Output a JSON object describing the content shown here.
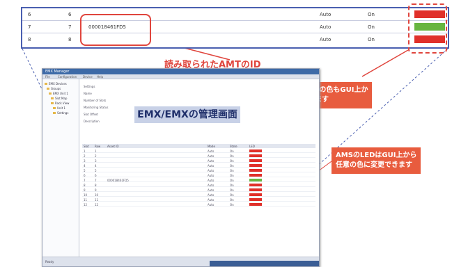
{
  "zoom_table": {
    "rows": [
      {
        "col1": "6",
        "col2": "6",
        "id": "",
        "mode": "Auto",
        "state": "On",
        "led_color": "#e0302a"
      },
      {
        "col1": "7",
        "col2": "7",
        "id": "000018461FD5",
        "mode": "Auto",
        "state": "On",
        "led_color": "#68b541"
      },
      {
        "col1": "8",
        "col2": "8",
        "id": "",
        "mode": "Auto",
        "state": "On",
        "led_color": "#e0302a"
      }
    ]
  },
  "annotations": {
    "amt_id": "読み取られたAMTのID",
    "led_status_line1": "AMSのLEDの色もGUI上か",
    "led_status_line2": "ら確認できます",
    "led_change_line1": "AMSのLEDはGUI上から",
    "led_change_line2": "任意の色に変更できます",
    "app_title": "EMX/EMXの管理画面"
  },
  "window": {
    "title": "EMX Manager",
    "menu": [
      "File",
      "Configuration",
      "Device",
      "Help"
    ],
    "tree": [
      "EMX Devices",
      "Groups",
      "EMX Unit 1",
      "Slot Map",
      "Rack View",
      "Unit 1",
      "Settings"
    ],
    "fields": [
      "Settings",
      "Name",
      "Number of Slots",
      "Monitoring Status",
      "Slot Offset",
      "Description"
    ],
    "grid_headers": [
      "Slot",
      "Row",
      "Asset ID",
      "Mode",
      "State",
      "LED"
    ],
    "grid_rows": [
      {
        "slot": "1",
        "row": "1",
        "id": "",
        "mode": "Auto",
        "state": "On",
        "led_color": "#e0302a"
      },
      {
        "slot": "2",
        "row": "2",
        "id": "",
        "mode": "Auto",
        "state": "On",
        "led_color": "#e0302a"
      },
      {
        "slot": "3",
        "row": "3",
        "id": "",
        "mode": "Auto",
        "state": "On",
        "led_color": "#e0302a"
      },
      {
        "slot": "4",
        "row": "4",
        "id": "",
        "mode": "Auto",
        "state": "On",
        "led_color": "#e0302a"
      },
      {
        "slot": "5",
        "row": "5",
        "id": "",
        "mode": "Auto",
        "state": "On",
        "led_color": "#e0302a"
      },
      {
        "slot": "6",
        "row": "6",
        "id": "",
        "mode": "Auto",
        "state": "On",
        "led_color": "#e0302a"
      },
      {
        "slot": "7",
        "row": "7",
        "id": "000018461FD5",
        "mode": "Auto",
        "state": "On",
        "led_color": "#68b541"
      },
      {
        "slot": "8",
        "row": "8",
        "id": "",
        "mode": "Auto",
        "state": "On",
        "led_color": "#e0302a"
      },
      {
        "slot": "9",
        "row": "9",
        "id": "",
        "mode": "Auto",
        "state": "On",
        "led_color": "#e0302a"
      },
      {
        "slot": "10",
        "row": "10",
        "id": "",
        "mode": "Auto",
        "state": "On",
        "led_color": "#e0302a"
      },
      {
        "slot": "11",
        "row": "11",
        "id": "",
        "mode": "Auto",
        "state": "On",
        "led_color": "#e0302a"
      },
      {
        "slot": "12",
        "row": "12",
        "id": "",
        "mode": "Auto",
        "state": "On",
        "led_color": "#e0302a"
      }
    ],
    "status": "Ready"
  }
}
